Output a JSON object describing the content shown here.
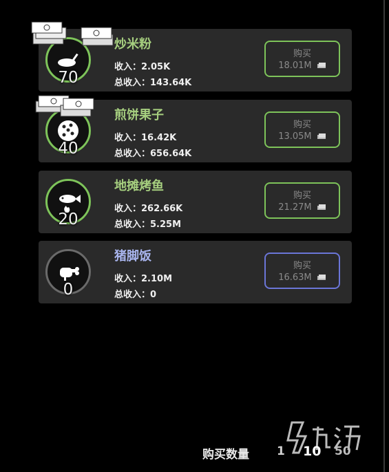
{
  "items": [
    {
      "name": "炒米粉",
      "level": "70",
      "income": "收入：2.05K",
      "total": "总收入：143.64K",
      "buy_label": "购买",
      "price": "18.01M",
      "icon": "frying-pan-icon",
      "accent": "#7ec45a"
    },
    {
      "name": "煎饼果子",
      "level": "40",
      "income": "收入：16.42K",
      "total": "总收入：656.64K",
      "buy_label": "购买",
      "price": "13.05M",
      "icon": "pancake-icon",
      "accent": "#7ec45a"
    },
    {
      "name": "地摊烤鱼",
      "level": "20",
      "income": "收入：262.66K",
      "total": "总收入：5.25M",
      "buy_label": "购买",
      "price": "21.27M",
      "icon": "grilled-fish-icon",
      "accent": "#7ec45a"
    },
    {
      "name": "猪脚饭",
      "level": "0",
      "income": "收入：2.10M",
      "total": "总收入：0",
      "buy_label": "购买",
      "price": "16.63M",
      "icon": "pork-leg-icon",
      "accent": "#6b76d8"
    }
  ],
  "footer": {
    "label": "购买数量",
    "options": [
      "1",
      "10",
      "50"
    ],
    "selected": "10"
  }
}
